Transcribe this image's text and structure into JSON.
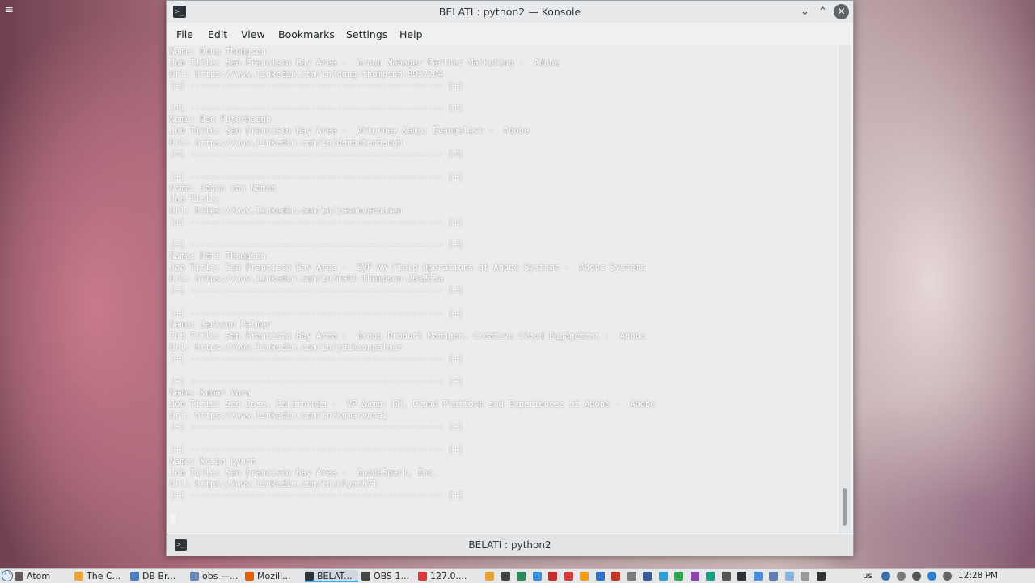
{
  "window": {
    "title": "BELATI : python2 — Konsole",
    "tab_label": "BELATI : python2"
  },
  "menu": [
    "File",
    "Edit",
    "View",
    "Bookmarks",
    "Settings",
    "Help"
  ],
  "terminal_lines": [
    "Name: Doug Thompson",
    "Job Title: San Francisco Bay Area -  Group Manager Partner Marketing -  Adobe",
    "Url: https://www.linkedin.com/in/doug-thompson-8937204",
    "[+] -------------------------------------------------- [+]",
    "",
    "[+] -------------------------------------------------- [+]",
    "Name: Dan Puterbaugh",
    "Job Title: San Francisco Bay Area -  Attorney &amp; Evangelist -  Adobe",
    "Url: https://www.linkedin.com/in/danputerbaugh",
    "[+] -------------------------------------------------- [+]",
    "",
    "[+] -------------------------------------------------- [+]",
    "Name: Jason van Namen",
    "Job Title:",
    "Url: https://www.linkedin.com/in/jasonvannamen",
    "[+] -------------------------------------------------- [+]",
    "",
    "[+] -------------------------------------------------- [+]",
    "Name: Matt Thompson",
    "Job Title: San Francisco Bay Area -  EVP WW Field Operations at Adobe Systems -  Adobe Systems",
    "Url: https://www.linkedin.com/in/matt-thompson-20a253a",
    "[+] -------------------------------------------------- [+]",
    "",
    "[+] -------------------------------------------------- [+]",
    "Name: Jackson Palmer",
    "Job Title: San Francisco Bay Area -  Group Product Manager, Creative Cloud Engagement -  Adobe",
    "Url: https://www.linkedin.com/in/jacksonpalmer",
    "[+] -------------------------------------------------- [+]",
    "",
    "[+] -------------------------------------------------- [+]",
    "Name: Kumar Vora",
    "Job Title: San Jose, California -  VP &amp; GM, Cloud Platform and Experiences at Adobe -  Adobe",
    "Url: https://www.linkedin.com/in/kumarvora1",
    "[+] -------------------------------------------------- [+]",
    "",
    "[+] -------------------------------------------------- [+]",
    "Name: Kevin Lynch",
    "Job Title: San Francisco Bay Area -  GuideSpark, Inc.",
    "Url: https://www.linkedin.com/in/klynch71",
    "[+] -------------------------------------------------- [+]"
  ],
  "taskbar": {
    "tasks": [
      {
        "label": "Atom",
        "color": "#66595c"
      },
      {
        "label": "The C...",
        "color": "#e8a33d"
      },
      {
        "label": "DB Br...",
        "color": "#4a7cc0"
      },
      {
        "label": "obs —...",
        "color": "#6a86b8"
      },
      {
        "label": "Mozill...",
        "color": "#e66000"
      },
      {
        "label": "BELAT...",
        "color": "#2f3337"
      },
      {
        "label": "OBS 1...",
        "color": "#444444"
      },
      {
        "label": "127.0....",
        "color": "#d63b3b"
      }
    ],
    "tray_colors": [
      "#e8a33d",
      "#444444",
      "#2e8b57",
      "#3a8fd8",
      "#c13030",
      "#d04040",
      "#f39c12",
      "#2f6fd0",
      "#c0392b",
      "#7b7b7b",
      "#3a5a9a",
      "#2c9fd8",
      "#35a853",
      "#8e44ad",
      "#16a085",
      "#555555",
      "#2f3337",
      "#4a90d9",
      "#5d7fb5",
      "#8ab4e0",
      "#999999",
      "#333333"
    ],
    "keyboard_layout": "us",
    "clock": "12:28 PM"
  }
}
